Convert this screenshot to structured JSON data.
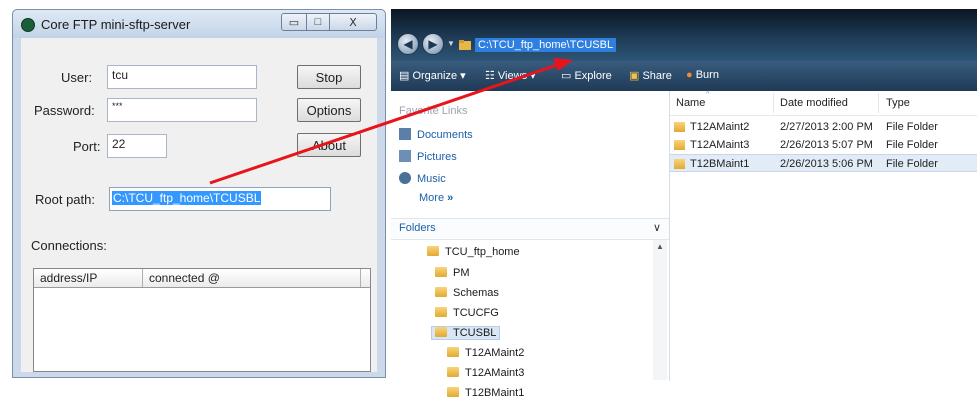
{
  "ftp": {
    "title": "Core FTP mini-sftp-server",
    "user_label": "User:",
    "user_value": "tcu",
    "password_label": "Password:",
    "password_value": "***",
    "port_label": "Port:",
    "port_value": "22",
    "root_label": "Root path:",
    "root_value": "C:\\TCU_ftp_home\\TCUSBL",
    "connections_label": "Connections:",
    "columns": [
      "address/IP",
      "connected @"
    ],
    "buttons": {
      "stop": "Stop",
      "options": "Options",
      "about": "About"
    },
    "window_buttons": {
      "close": "X"
    }
  },
  "explorer": {
    "address": "C:\\TCU_ftp_home\\TCUSBL",
    "toolbar": {
      "organize": "Organize",
      "views": "Views",
      "explore": "Explore",
      "share": "Share",
      "burn": "Burn"
    },
    "favorites_header": "Favorite Links",
    "favorites": [
      "Documents",
      "Pictures",
      "Music"
    ],
    "more": "More",
    "folders_label": "Folders",
    "tree": [
      "TCU_ftp_home",
      "PM",
      "Schemas",
      "TCUCFG",
      "TCUSBL",
      "T12AMaint2",
      "T12AMaint3",
      "T12BMaint1"
    ],
    "columns": [
      "Name",
      "Date modified",
      "Type"
    ],
    "files": [
      {
        "name": "T12AMaint2",
        "date": "2/27/2013 2:00 PM",
        "type": "File Folder"
      },
      {
        "name": "T12AMaint3",
        "date": "2/26/2013 5:07 PM",
        "type": "File Folder"
      },
      {
        "name": "T12BMaint1",
        "date": "2/26/2013 5:06 PM",
        "type": "File Folder"
      }
    ]
  },
  "colors": {
    "arrow": "#e8131b",
    "selection": "#3399ff"
  }
}
